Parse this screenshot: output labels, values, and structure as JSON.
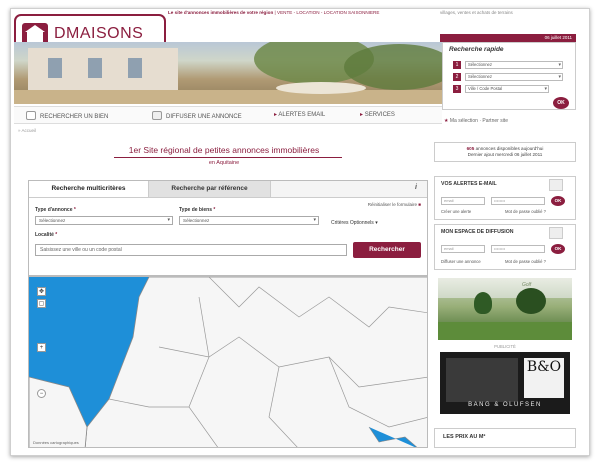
{
  "header": {
    "tagline": "Le site d'annonces immobilières de votre région",
    "tagline_links": "| VENTE - LOCATION - LOCATION SAISONNIERE",
    "top_links": "villages, ventes et achats de terrains",
    "date": "06 juillet 2011"
  },
  "logo": {
    "name": "DMAISONS",
    "region": "AQUITAINE"
  },
  "quick_search": {
    "title": "Recherche rapide",
    "field1": "Sélectionnez",
    "field2": "Sélectionnez",
    "field3": "Ville / Code Postal",
    "num1": "1",
    "num2": "2",
    "num3": "3",
    "ok": "OK"
  },
  "nav": {
    "items": [
      {
        "label": "RECHERCHER UN BIEN"
      },
      {
        "label": "DIFFUSER UNE ANNONCE"
      },
      {
        "label": "ALERTES EMAIL"
      },
      {
        "label": "SERVICES"
      }
    ],
    "selection": "Ma sélection",
    "partner": "Partner site",
    "breadcrumb": "Accueil"
  },
  "headline": {
    "title": "1er Site régional de petites annonces immobilières",
    "subtitle": "en Aquitaine"
  },
  "announce": {
    "count": "605",
    "line1": "annonces disponibles aujourd'hui",
    "line2": "Dernier ajout mercredi 06 juillet 2011"
  },
  "search": {
    "tab_active": "Recherche multicritères",
    "tab_inactive": "Recherche par référence",
    "info_icon": "i",
    "reinit": "Réinitialiser le formulaire",
    "type_annonce_label": "Type d'annonce",
    "type_annonce_value": "Sélectionnez",
    "type_bien_label": "Type de biens",
    "type_bien_value": "Sélectionnez",
    "criteria": "Critères Optionnels",
    "localite_label": "Localité",
    "localite_placeholder": "Saisissez une ville ou un code postal",
    "button": "Rechercher"
  },
  "map": {
    "footer": "Données cartographiques"
  },
  "alerts": {
    "title": "VOS ALERTES E-MAIL",
    "email_placeholder": "email",
    "pass_placeholder": "••••••••",
    "ok": "OK",
    "link_create": "Créer une alerte",
    "link_forgot": "Mot de passe oublié ?"
  },
  "diffusion": {
    "title": "MON ESPACE DE DIFFUSION",
    "email_placeholder": "email",
    "pass_placeholder": "••••••••",
    "ok": "OK",
    "link_diffuse": "Diffuser une annonce",
    "link_forgot": "Mot de passe oublié ?"
  },
  "ads": {
    "label": "PUBLICITÉ",
    "brand": "BANG & OLUFSEN",
    "logo": "B&O",
    "golf_caption": "Golf"
  },
  "prix": {
    "title": "LES PRIX AU M²"
  },
  "colors": {
    "brand": "#8b1e3f",
    "sea": "#1e8fd8",
    "land": "#f7f7f7"
  }
}
